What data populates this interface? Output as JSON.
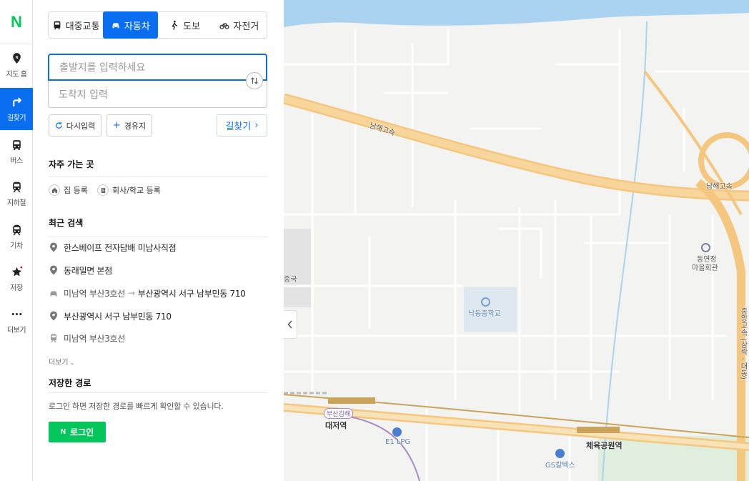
{
  "brand": {
    "logo": "N"
  },
  "rail": [
    {
      "label": "지도 홈",
      "icon": "map-pin-icon"
    },
    {
      "label": "길찾기",
      "icon": "directions-icon"
    },
    {
      "label": "버스",
      "icon": "bus-icon"
    },
    {
      "label": "지하철",
      "icon": "subway-icon"
    },
    {
      "label": "기차",
      "icon": "train-icon"
    },
    {
      "label": "저장",
      "icon": "star-icon"
    },
    {
      "label": "더보기",
      "icon": "more-icon"
    }
  ],
  "tabs": [
    {
      "label": "대중교통",
      "icon": "bus-icon"
    },
    {
      "label": "자동차",
      "icon": "car-icon",
      "active": true
    },
    {
      "label": "도보",
      "icon": "walk-icon"
    },
    {
      "label": "자전거",
      "icon": "bike-icon"
    }
  ],
  "route": {
    "from_placeholder": "출발지를 입력하세요",
    "to_placeholder": "도착지 입력"
  },
  "actions": {
    "reset": "다시입력",
    "via": "경유지",
    "search": "길찾기"
  },
  "frequent": {
    "title": "자주 가는 곳",
    "home": "집 등록",
    "work": "회사/학교 등록"
  },
  "recent": {
    "title": "최근 검색",
    "items": [
      {
        "type": "place",
        "text": "한스베이프 전자담배 미남사직점"
      },
      {
        "type": "place",
        "text": "동래밀면 본점"
      },
      {
        "type": "route",
        "from": "미남역 부산3호선",
        "to": "부산광역시 서구 남부민동 710"
      },
      {
        "type": "place",
        "text": "부산광역시 서구 남부민동 710"
      },
      {
        "type": "transit",
        "text": "미남역 부산3호선"
      }
    ],
    "more": "더보기"
  },
  "saved": {
    "title": "저장한 경로",
    "desc": "로그인 하면 저장한 경로를 빠르게 확인할 수 있습니다.",
    "login": "로그인"
  },
  "map": {
    "labels": {
      "highway1": "남해고속",
      "highway2": "남해고속",
      "community": "동연정",
      "community2": "마을회관",
      "school": "낙동중학교",
      "station1": "대저역",
      "line_badge": "부산김해",
      "lpg": "E1 LPG",
      "station2": "체육공원역",
      "gas": "GS칼텍스",
      "partial": "중국",
      "expressway": "중앙고속 (삼락 - 대동)"
    },
    "colors": {
      "road": "#f5c77e",
      "water": "#a9d3f0",
      "rail": "#c9a45a",
      "park": "#dfeedd"
    }
  }
}
